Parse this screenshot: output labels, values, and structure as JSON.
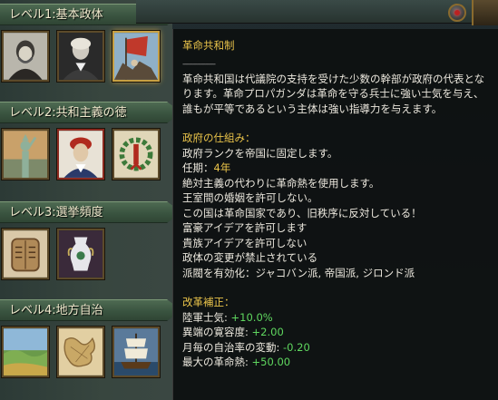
{
  "levels": [
    {
      "label": "レベル1:",
      "name": "基本政体",
      "icons": [
        "explorer-portrait-icon",
        "founder-portrait-icon",
        "revolution-flag-icon"
      ]
    },
    {
      "label": "レベル2:",
      "name": "共和主義の徳",
      "icons": [
        "liberty-statue-icon",
        "revolutionary-leader-icon",
        "laurel-wreath-icon"
      ]
    },
    {
      "label": "レベル3:",
      "name": "選挙頻度",
      "icons": [
        "law-tablets-icon",
        "ornate-vase-icon"
      ]
    },
    {
      "label": "レベル4:",
      "name": "地方自治",
      "icons": [
        "countryside-landscape-icon",
        "old-map-icon",
        "sailing-ship-icon"
      ]
    }
  ],
  "tooltip": {
    "title": "革命共和制",
    "rule": "----------------",
    "description": "革命共和国は代議院の支持を受けた少数の幹部が政府の代表となります。革命プロパガンダは革命を守る兵士に強い士気を与え、誰もが平等であるという主体は強い指導力を与えます。",
    "mechanics_title": "政府の仕組み：",
    "mechanics": [
      {
        "text": "政府ランクを帝国に固定します。"
      },
      {
        "text": "任期：",
        "value": "4年"
      },
      {
        "text": "絶対主義の代わりに革命熱を使用します。"
      },
      {
        "text": "王室間の婚姻を許可しない。"
      },
      {
        "text": "この国は革命国家であり、旧秩序に反対している！"
      },
      {
        "text": "富豪アイデアを許可します"
      },
      {
        "text": "貴族アイデアを許可しない"
      },
      {
        "text": "政体の変更が禁止されている"
      },
      {
        "text": "派閥を有効化：ジャコバン派, 帝国派, ジロンド派"
      }
    ],
    "modifiers_title": "改革補正：",
    "modifiers": [
      {
        "label": "陸軍士気: ",
        "value": "+10.0%"
      },
      {
        "label": "異端の寛容度: ",
        "value": "+2.00"
      },
      {
        "label": "月毎の自治率の変動: ",
        "value": "-0.20"
      },
      {
        "label": "最大の革命熱: ",
        "value": "+50.00"
      }
    ]
  },
  "colors": {
    "accent_gold": "#e9c34a",
    "positive_green": "#5fd75f",
    "header_green": "#3a5440"
  }
}
